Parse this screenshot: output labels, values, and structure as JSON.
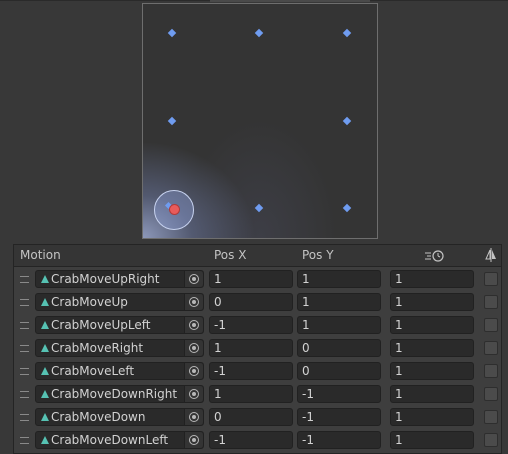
{
  "header": {
    "motion": "Motion",
    "pos_x": "Pos X",
    "pos_y": "Pos Y",
    "speed_icon": "speed-time-icon",
    "mirror_icon": "mirror-icon"
  },
  "colors": {
    "point": "#6f9cf0",
    "selected_point": "#e85b5b",
    "clip_icon": "#56c2b3"
  },
  "motions": [
    {
      "name": "CrabMoveUpRight",
      "pos_x": "1",
      "pos_y": "1",
      "speed": "1"
    },
    {
      "name": "CrabMoveUp",
      "pos_x": "0",
      "pos_y": "1",
      "speed": "1"
    },
    {
      "name": "CrabMoveUpLeft",
      "pos_x": "-1",
      "pos_y": "1",
      "speed": "1"
    },
    {
      "name": "CrabMoveRight",
      "pos_x": "1",
      "pos_y": "0",
      "speed": "1"
    },
    {
      "name": "CrabMoveLeft",
      "pos_x": "-1",
      "pos_y": "0",
      "speed": "1"
    },
    {
      "name": "CrabMoveDownRight",
      "pos_x": "1",
      "pos_y": "-1",
      "speed": "1"
    },
    {
      "name": "CrabMoveDown",
      "pos_x": "0",
      "pos_y": "-1",
      "speed": "1"
    },
    {
      "name": "CrabMoveDownLeft",
      "pos_x": "-1",
      "pos_y": "-1",
      "speed": "1"
    }
  ]
}
